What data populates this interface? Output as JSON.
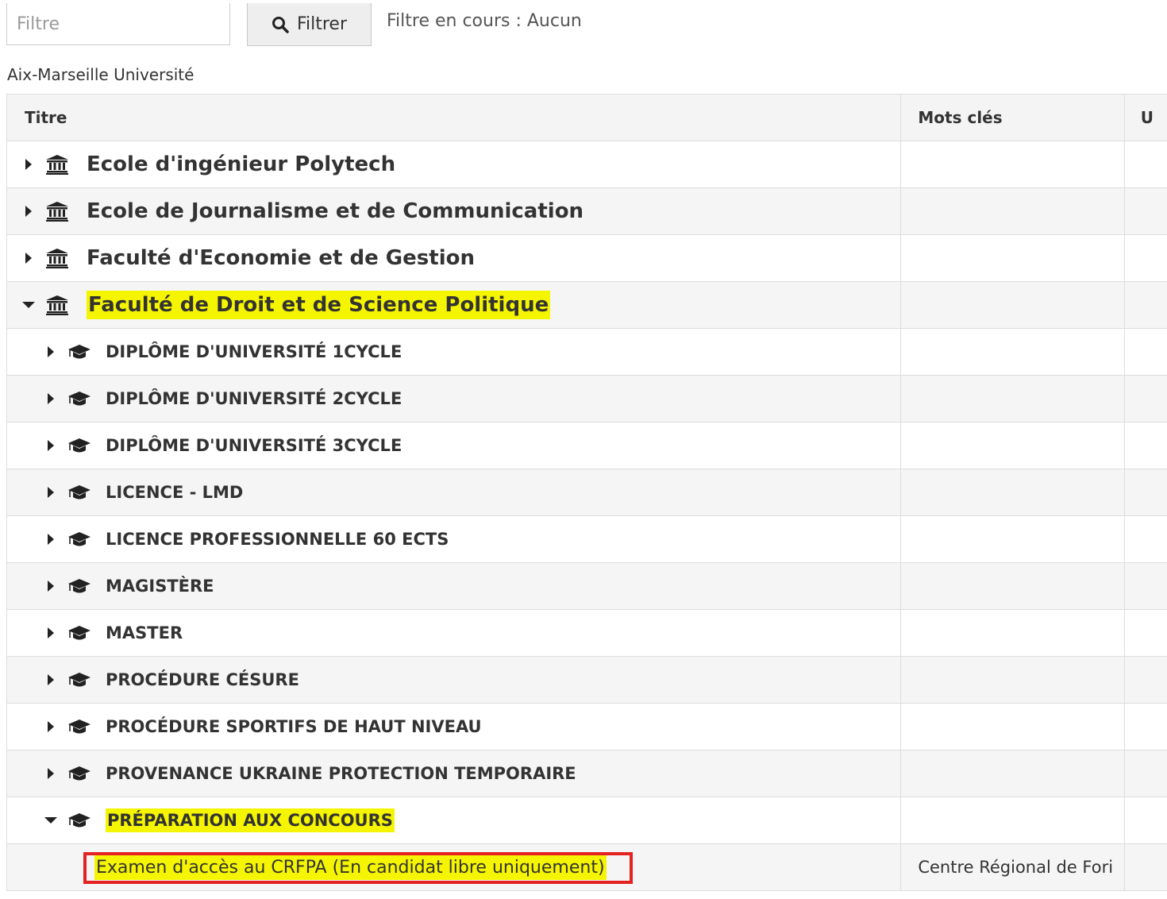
{
  "filter": {
    "placeholder": "Filtre",
    "button_label": "Filtrer",
    "status": "Filtre en cours : Aucun"
  },
  "university": "Aix-Marseille Université",
  "table": {
    "headers": {
      "title": "Titre",
      "keywords": "Mots clés",
      "third": "U"
    },
    "faculties": [
      {
        "label": "Ecole d'ingénieur Polytech",
        "expanded": false
      },
      {
        "label": "Ecole de Journalisme et de Communication",
        "expanded": false
      },
      {
        "label": "Faculté d'Economie et de Gestion",
        "expanded": false
      },
      {
        "label": "Faculté de Droit et de Science Politique",
        "expanded": true,
        "highlighted": true
      }
    ],
    "programs": [
      {
        "label": "DIPLÔME D'UNIVERSITÉ 1CYCLE",
        "expanded": false
      },
      {
        "label": "DIPLÔME D'UNIVERSITÉ 2CYCLE",
        "expanded": false
      },
      {
        "label": "DIPLÔME D'UNIVERSITÉ 3CYCLE",
        "expanded": false
      },
      {
        "label": "LICENCE - LMD",
        "expanded": false
      },
      {
        "label": "LICENCE PROFESSIONNELLE 60 ECTS",
        "expanded": false
      },
      {
        "label": "MAGISTÈRE",
        "expanded": false
      },
      {
        "label": "MASTER",
        "expanded": false
      },
      {
        "label": "PROCÉDURE CÉSURE",
        "expanded": false
      },
      {
        "label": "PROCÉDURE SPORTIFS DE HAUT NIVEAU",
        "expanded": false
      },
      {
        "label": "PROVENANCE UKRAINE PROTECTION TEMPORAIRE",
        "expanded": false
      },
      {
        "label": "PRÉPARATION AUX CONCOURS",
        "expanded": true,
        "highlighted": true
      }
    ],
    "course": {
      "label": "Examen d'accès au CRFPA (En candidat libre uniquement)",
      "keywords": "Centre Régional de Fori"
    }
  },
  "icons": {
    "search": "search-icon",
    "institution": "institution-icon",
    "graduation": "graduation-cap-icon"
  },
  "colors": {
    "highlight": "#f6f500",
    "annotation_box": "#e52222"
  }
}
